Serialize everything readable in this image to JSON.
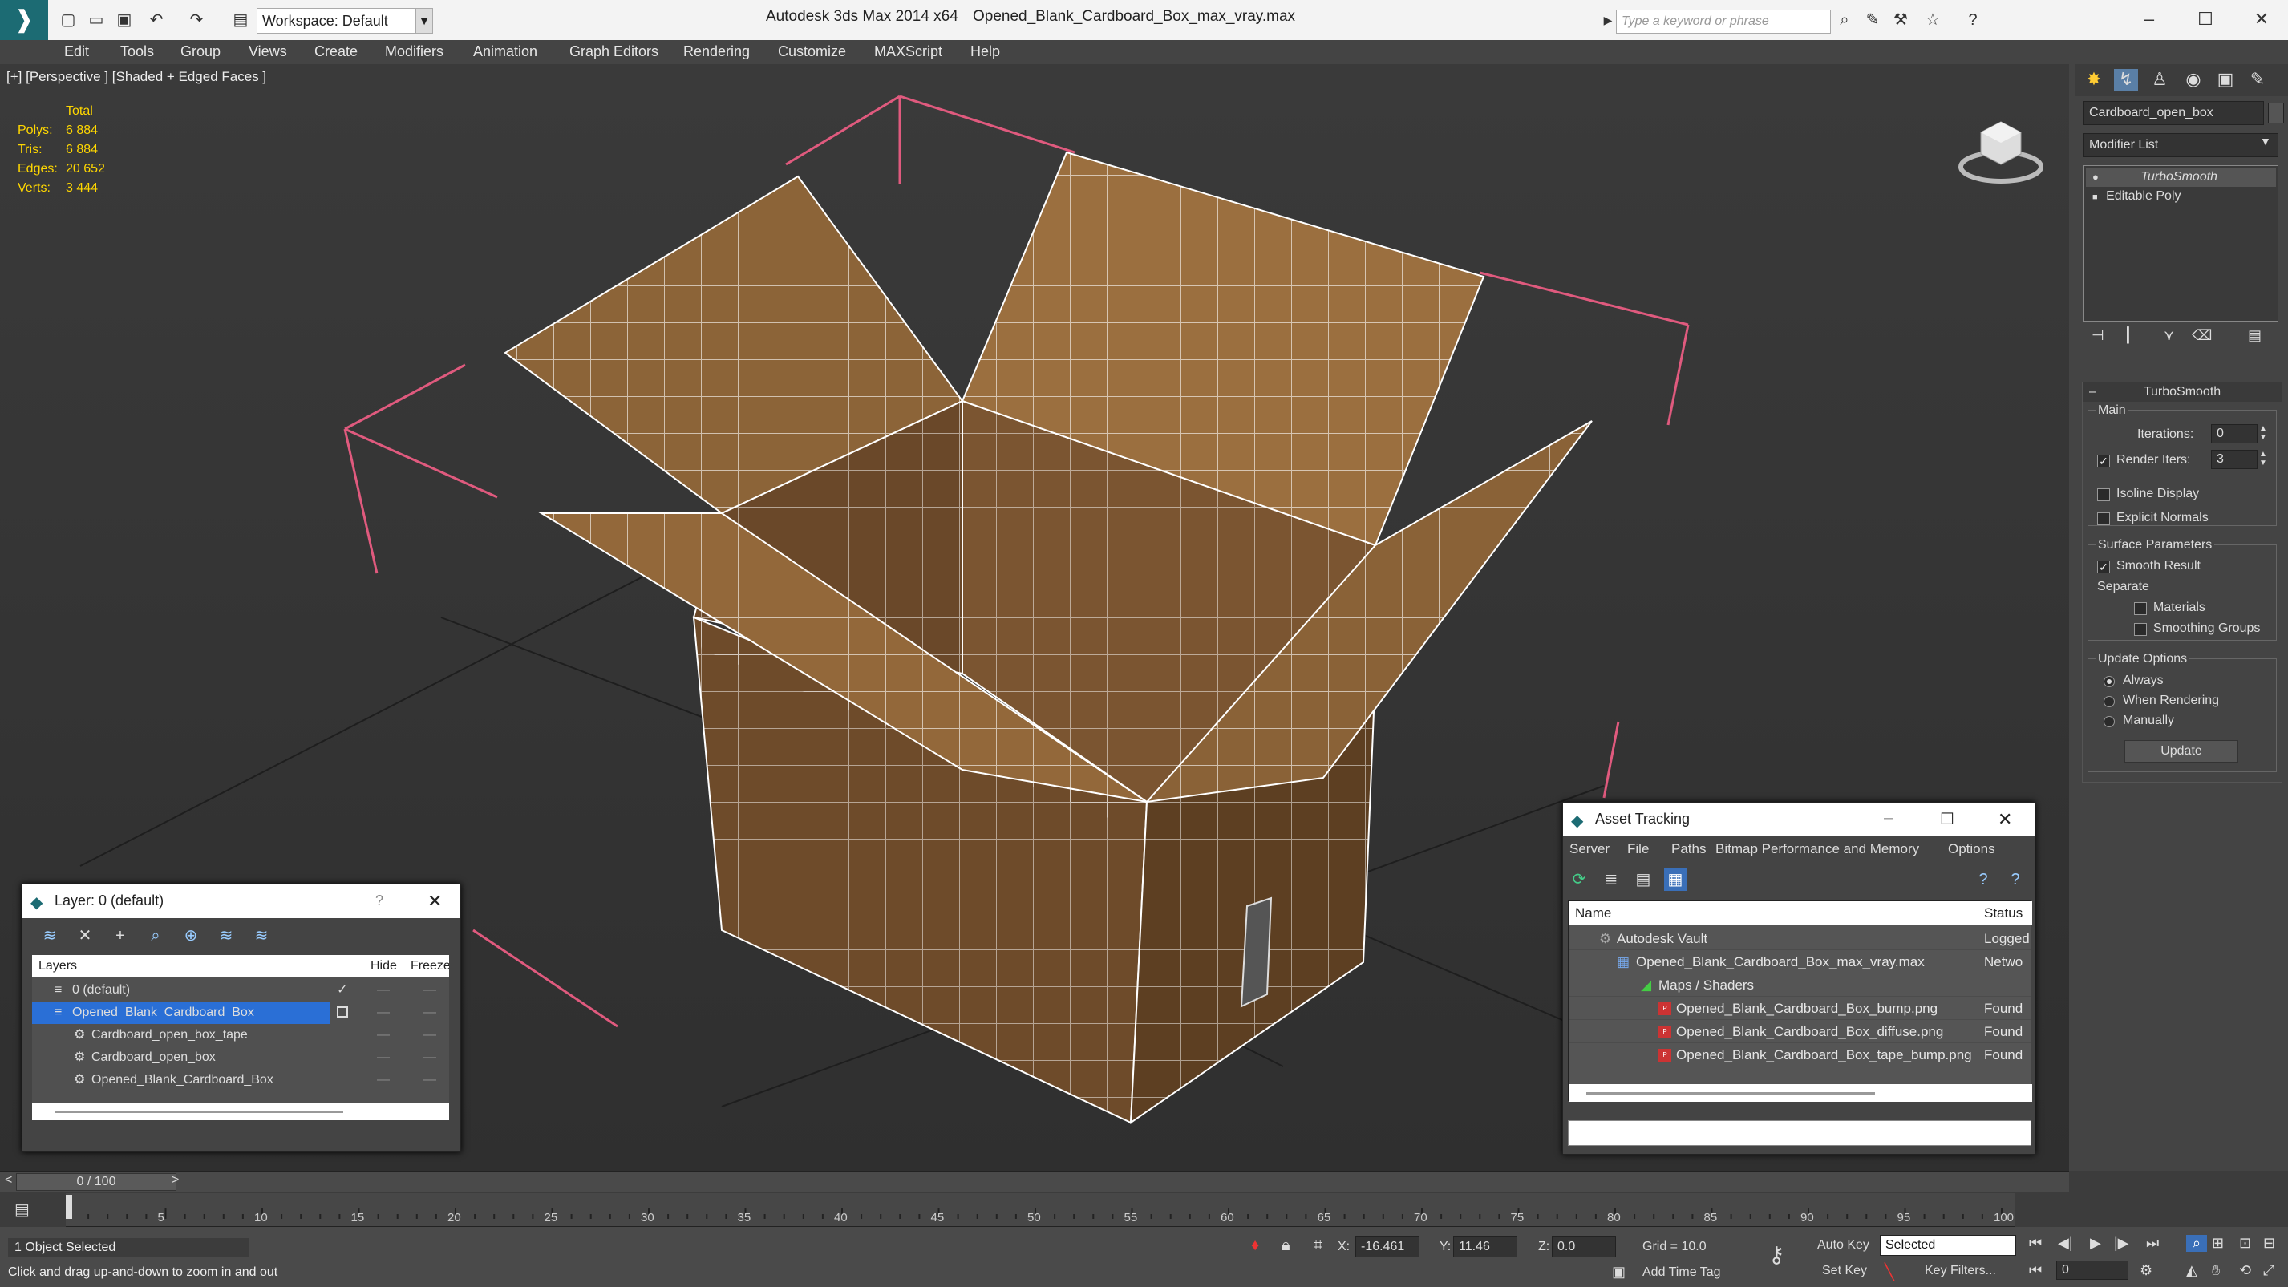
{
  "titlebar": {
    "app": "Autodesk 3ds Max  2014 x64",
    "file": "Opened_Blank_Cardboard_Box_max_vray.max",
    "workspace": "Workspace: Default",
    "search_placeholder": "Type a keyword or phrase"
  },
  "menu": [
    "Edit",
    "Tools",
    "Group",
    "Views",
    "Create",
    "Modifiers",
    "Animation",
    "Graph Editors",
    "Rendering",
    "Customize",
    "MAXScript",
    "Help"
  ],
  "viewport": {
    "label": "[+] [Perspective ] [Shaded + Edged Faces ]",
    "stats": {
      "header": "Total",
      "rows": [
        {
          "k": "Polys:",
          "v": "6 884"
        },
        {
          "k": "Tris:",
          "v": "6 884"
        },
        {
          "k": "Edges:",
          "v": "20 652"
        },
        {
          "k": "Verts:",
          "v": "3 444"
        }
      ]
    }
  },
  "command_panel": {
    "object_name": "Cardboard_open_box",
    "modifier_list": "Modifier List",
    "stack": [
      "TurboSmooth",
      "Editable Poly"
    ],
    "rollout_title": "TurboSmooth",
    "main": {
      "label": "Main",
      "iterations_label": "Iterations:",
      "iterations": "0",
      "render_iters_label": "Render Iters:",
      "render_iters": "3",
      "isoline": "Isoline Display",
      "explicit": "Explicit Normals"
    },
    "surface": {
      "label": "Surface Parameters",
      "smooth": "Smooth Result",
      "separate": "Separate",
      "materials": "Materials",
      "smoothing": "Smoothing Groups"
    },
    "update": {
      "label": "Update Options",
      "always": "Always",
      "when_rendering": "When Rendering",
      "manually": "Manually",
      "button": "Update"
    }
  },
  "layer_dialog": {
    "title": "Layer: 0 (default)",
    "help": "?",
    "col_layers": "Layers",
    "col_hide": "Hide",
    "col_freeze": "Freeze",
    "rows": [
      {
        "name": "0 (default)",
        "indent": 0,
        "selected": false,
        "check": "✓"
      },
      {
        "name": "Opened_Blank_Cardboard_Box",
        "indent": 0,
        "selected": true,
        "check": ""
      },
      {
        "name": "Cardboard_open_box_tape",
        "indent": 1,
        "selected": false,
        "check": ""
      },
      {
        "name": "Cardboard_open_box",
        "indent": 1,
        "selected": false,
        "check": ""
      },
      {
        "name": "Opened_Blank_Cardboard_Box",
        "indent": 1,
        "selected": false,
        "check": ""
      }
    ]
  },
  "asset_dialog": {
    "title": "Asset Tracking",
    "menu": [
      "Server",
      "File",
      "Paths",
      "Bitmap Performance and Memory",
      "Options"
    ],
    "col_name": "Name",
    "col_status": "Status",
    "rows": [
      {
        "name": "Autodesk Vault",
        "status": "Logged",
        "indent": 1
      },
      {
        "name": "Opened_Blank_Cardboard_Box_max_vray.max",
        "status": "Netwo",
        "indent": 2
      },
      {
        "name": "Maps / Shaders",
        "status": "",
        "indent": 3
      },
      {
        "name": "Opened_Blank_Cardboard_Box_bump.png",
        "status": "Found",
        "indent": 4
      },
      {
        "name": "Opened_Blank_Cardboard_Box_diffuse.png",
        "status": "Found",
        "indent": 4
      },
      {
        "name": "Opened_Blank_Cardboard_Box_tape_bump.png",
        "status": "Found",
        "indent": 4
      }
    ]
  },
  "timeline": {
    "frame": "0 / 100",
    "ticks": [
      "5",
      "10",
      "15",
      "20",
      "25",
      "30",
      "35",
      "40",
      "45",
      "50",
      "55",
      "60",
      "65",
      "70",
      "75",
      "80",
      "85",
      "90",
      "95",
      "100"
    ]
  },
  "status": {
    "selected": "1 Object Selected",
    "prompt": "Click and drag up-and-down to zoom in and out",
    "x_label": "X:",
    "x": "-16.461",
    "y_label": "Y:",
    "y": "11.46",
    "z_label": "Z:",
    "z": "0.0",
    "grid": "Grid = 10.0",
    "add_time_tag": "Add Time Tag",
    "auto_key": "Auto Key",
    "set_key": "Set Key",
    "key_mode": "Selected",
    "key_filters": "Key Filters...",
    "frame_field": "0"
  }
}
